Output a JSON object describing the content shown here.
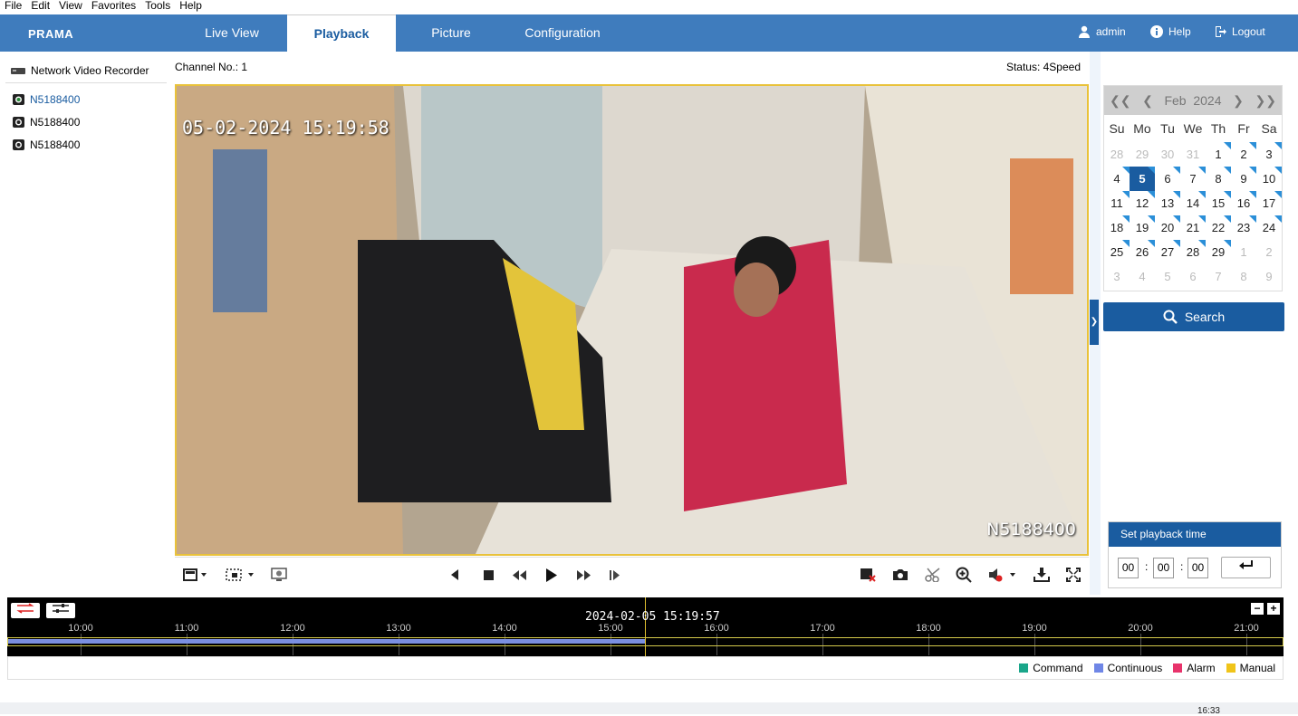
{
  "menubar": [
    "File",
    "Edit",
    "View",
    "Favorites",
    "Tools",
    "Help"
  ],
  "nav": {
    "logo": "PRAMA",
    "tabs": [
      {
        "label": "Live View",
        "active": false
      },
      {
        "label": "Playback",
        "active": true
      },
      {
        "label": "Picture",
        "active": false
      },
      {
        "label": "Configuration",
        "active": false
      }
    ],
    "user": "admin",
    "help": "Help",
    "logout": "Logout"
  },
  "tree": {
    "root": "Network Video Recorder",
    "items": [
      "N5188400",
      "N5188400",
      "N5188400"
    ],
    "selected_index": 0
  },
  "header": {
    "channel": "Channel No.: 1",
    "status": "Status: 4Speed"
  },
  "video": {
    "osd_time": "05-02-2024 15:19:58",
    "osd_camera": "N5188400"
  },
  "calendar": {
    "month": "Feb",
    "year": "2024",
    "weekdays": [
      "Su",
      "Mo",
      "Tu",
      "We",
      "Th",
      "Fr",
      "Sa"
    ],
    "cells": [
      {
        "d": "28",
        "other": true,
        "rec": false
      },
      {
        "d": "29",
        "other": true,
        "rec": false
      },
      {
        "d": "30",
        "other": true,
        "rec": false
      },
      {
        "d": "31",
        "other": true,
        "rec": false
      },
      {
        "d": "1",
        "other": false,
        "rec": true
      },
      {
        "d": "2",
        "other": false,
        "rec": true
      },
      {
        "d": "3",
        "other": false,
        "rec": true
      },
      {
        "d": "4",
        "other": false,
        "rec": true
      },
      {
        "d": "5",
        "other": false,
        "rec": true,
        "today": true
      },
      {
        "d": "6",
        "other": false,
        "rec": true
      },
      {
        "d": "7",
        "other": false,
        "rec": true
      },
      {
        "d": "8",
        "other": false,
        "rec": true
      },
      {
        "d": "9",
        "other": false,
        "rec": true
      },
      {
        "d": "10",
        "other": false,
        "rec": true
      },
      {
        "d": "11",
        "other": false,
        "rec": true
      },
      {
        "d": "12",
        "other": false,
        "rec": true
      },
      {
        "d": "13",
        "other": false,
        "rec": true
      },
      {
        "d": "14",
        "other": false,
        "rec": true
      },
      {
        "d": "15",
        "other": false,
        "rec": true
      },
      {
        "d": "16",
        "other": false,
        "rec": true
      },
      {
        "d": "17",
        "other": false,
        "rec": true
      },
      {
        "d": "18",
        "other": false,
        "rec": true
      },
      {
        "d": "19",
        "other": false,
        "rec": true
      },
      {
        "d": "20",
        "other": false,
        "rec": true
      },
      {
        "d": "21",
        "other": false,
        "rec": true
      },
      {
        "d": "22",
        "other": false,
        "rec": true
      },
      {
        "d": "23",
        "other": false,
        "rec": true
      },
      {
        "d": "24",
        "other": false,
        "rec": true
      },
      {
        "d": "25",
        "other": false,
        "rec": true
      },
      {
        "d": "26",
        "other": false,
        "rec": true
      },
      {
        "d": "27",
        "other": false,
        "rec": true
      },
      {
        "d": "28",
        "other": false,
        "rec": true
      },
      {
        "d": "29",
        "other": false,
        "rec": true
      },
      {
        "d": "1",
        "other": true,
        "rec": false
      },
      {
        "d": "2",
        "other": true,
        "rec": false
      },
      {
        "d": "3",
        "other": true,
        "rec": false
      },
      {
        "d": "4",
        "other": true,
        "rec": false
      },
      {
        "d": "5",
        "other": true,
        "rec": false
      },
      {
        "d": "6",
        "other": true,
        "rec": false
      },
      {
        "d": "7",
        "other": true,
        "rec": false
      },
      {
        "d": "8",
        "other": true,
        "rec": false
      },
      {
        "d": "9",
        "other": true,
        "rec": false
      }
    ]
  },
  "search": {
    "label": "Search"
  },
  "playback_time": {
    "title": "Set playback time",
    "hh": "00",
    "mm": "00",
    "ss": "00",
    "enter_icon": "enter-icon"
  },
  "timeline": {
    "current": "2024-02-05 15:19:57",
    "hours": [
      "10:00",
      "11:00",
      "12:00",
      "13:00",
      "14:00",
      "15:00",
      "16:00",
      "17:00",
      "18:00",
      "19:00",
      "20:00",
      "21:00"
    ],
    "recorded_fraction": 0.5
  },
  "legend": [
    {
      "label": "Command",
      "color": "#1aa68a"
    },
    {
      "label": "Continuous",
      "color": "#6f86e6"
    },
    {
      "label": "Alarm",
      "color": "#e8336b"
    },
    {
      "label": "Manual",
      "color": "#f0c419"
    }
  ],
  "taskbar": {
    "clock": "16:33"
  }
}
